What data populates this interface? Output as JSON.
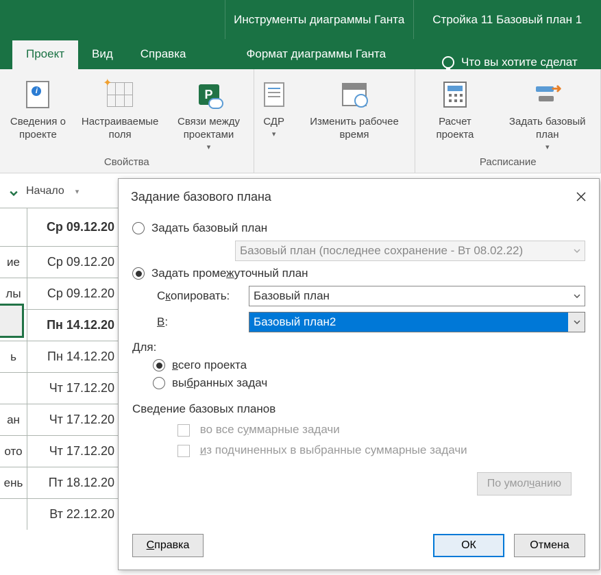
{
  "context": {
    "gantt_tools": "Инструменты диаграммы Ганта",
    "file_title": "Стройка 11 Базовый план 1"
  },
  "tabs": {
    "project": "Проект",
    "view": "Вид",
    "help": "Справка",
    "format": "Формат диаграммы Ганта",
    "tell_me": "Что вы хотите сделат"
  },
  "ribbon": {
    "info": "Сведения о проекте",
    "custom_fields": "Настраиваемые поля",
    "links": "Связи между проектами",
    "wbs": "СДР",
    "change_time": "Изменить рабочее время",
    "group_props": "Свойства",
    "calc": "Расчет проекта",
    "set_baseline": "Задать базовый план",
    "group_schedule": "Расписание"
  },
  "grid": {
    "header_start": "Начало",
    "rows": [
      {
        "c0": "",
        "c1": "Ср 09.12.20",
        "bold": true
      },
      {
        "c0": "ие",
        "c1": "Ср 09.12.20"
      },
      {
        "c0": "лы",
        "c1": "Ср 09.12.20"
      },
      {
        "c0": "",
        "c1": "Пн 14.12.20",
        "bold": true
      },
      {
        "c0": "ь",
        "c1": "Пн 14.12.20"
      },
      {
        "c0": "",
        "c1": "Чт 17.12.20"
      },
      {
        "c0": "ан",
        "c1": "Чт 17.12.20"
      },
      {
        "c0": "ото",
        "c1": "Чт 17.12.20"
      },
      {
        "c0": "ень",
        "c1": "Пт 18.12.20"
      },
      {
        "c0": "",
        "c1": "Вт 22.12.20"
      }
    ]
  },
  "dialog": {
    "title": "Задание базового плана",
    "radio_baseline": "Задать базовый план",
    "combo_baseline_disabled": "Базовый план (последнее сохранение - Вт 08.02.22)",
    "radio_interim": "Задать промежуточный план",
    "lbl_copy": "Скопировать:",
    "combo_copy": "Базовый план",
    "lbl_into": "В:",
    "combo_into": "Базовый план2",
    "for_label": "Для:",
    "radio_whole": "всего проекта",
    "radio_selected": "выбранных задач",
    "rollup_title": "Сведение базовых планов",
    "check_all_summary": "во все суммарные задачи",
    "check_from_sub": "из подчиненных в выбранные суммарные задачи",
    "btn_defaults": "По умолчанию",
    "btn_help": "Справка",
    "btn_ok": "ОК",
    "btn_cancel": "Отмена"
  }
}
